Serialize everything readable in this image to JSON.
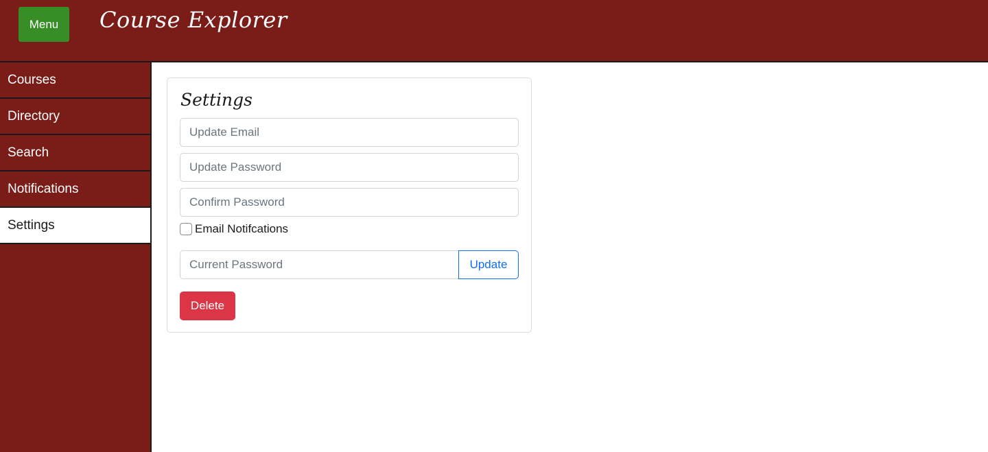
{
  "header": {
    "menu_label": "Menu",
    "app_title": "Course Explorer",
    "background_color": "#7a1c18",
    "menu_button_color": "#388e26"
  },
  "sidebar": {
    "items": [
      {
        "label": "Courses",
        "active": false
      },
      {
        "label": "Directory",
        "active": false
      },
      {
        "label": "Search",
        "active": false
      },
      {
        "label": "Notifications",
        "active": false
      },
      {
        "label": "Settings",
        "active": true
      }
    ]
  },
  "settings": {
    "title": "Settings",
    "email_placeholder": "Update Email",
    "password_placeholder": "Update Password",
    "confirm_placeholder": "Confirm Password",
    "email_notifications_label": "Email Notifcations",
    "email_notifications_checked": false,
    "current_password_placeholder": "Current Password",
    "update_label": "Update",
    "delete_label": "Delete",
    "delete_color": "#dc3545",
    "update_color": "#0d6efd"
  }
}
